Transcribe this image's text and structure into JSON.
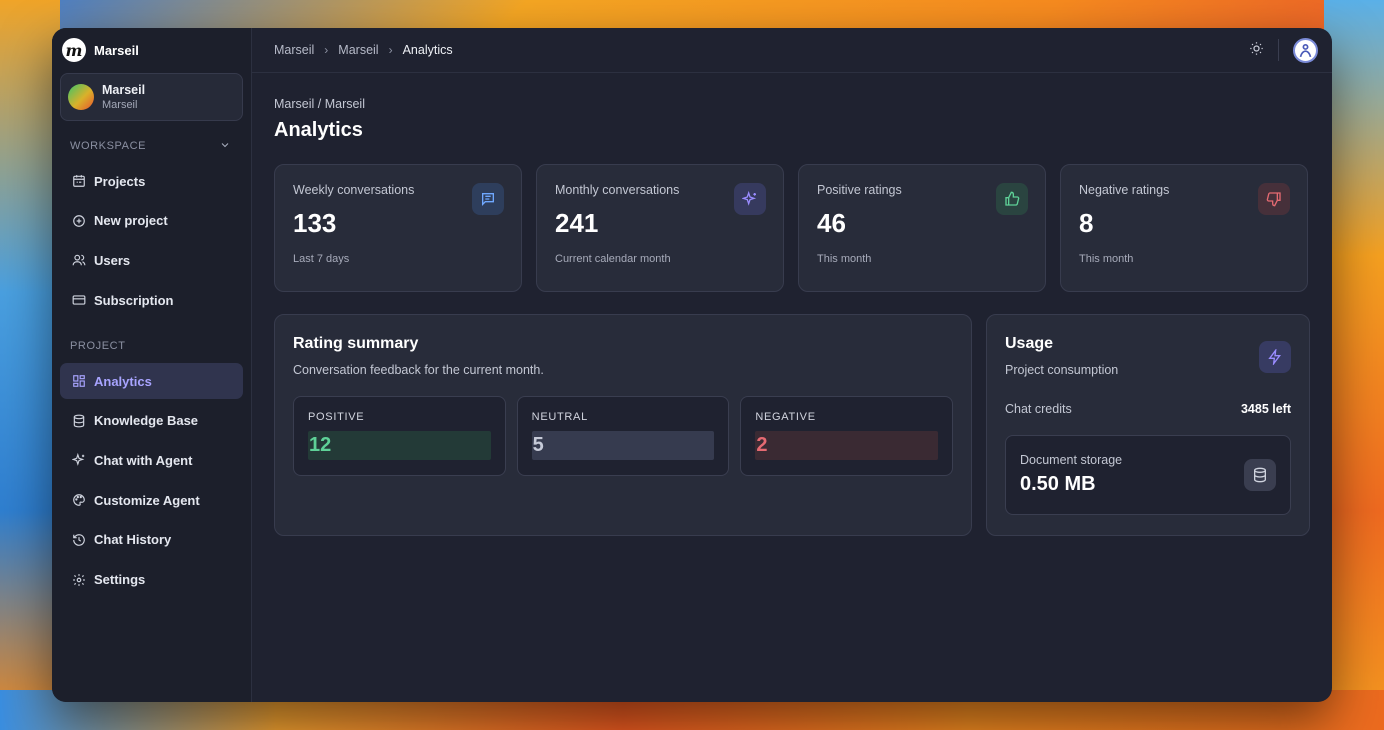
{
  "brand": {
    "name": "Marseil"
  },
  "account": {
    "name": "Marseil",
    "sub": "Marseil"
  },
  "sidebar": {
    "workspace_label": "WORKSPACE",
    "workspace_items": [
      {
        "label": "Projects",
        "icon": "calendar-icon"
      },
      {
        "label": "New project",
        "icon": "plus-circle-icon"
      },
      {
        "label": "Users",
        "icon": "users-icon"
      },
      {
        "label": "Subscription",
        "icon": "credit-card-icon"
      }
    ],
    "project_label": "PROJECT",
    "project_items": [
      {
        "label": "Analytics",
        "icon": "grid-icon",
        "active": true
      },
      {
        "label": "Knowledge Base",
        "icon": "database-icon"
      },
      {
        "label": "Chat with Agent",
        "icon": "sparkles-icon"
      },
      {
        "label": "Customize Agent",
        "icon": "palette-icon"
      },
      {
        "label": "Chat History",
        "icon": "history-icon"
      },
      {
        "label": "Settings",
        "icon": "gear-icon"
      }
    ]
  },
  "topbar": {
    "breadcrumbs": [
      "Marseil",
      "Marseil",
      "Analytics"
    ]
  },
  "page": {
    "crumb": "Marseil / Marseil",
    "title": "Analytics"
  },
  "stats": [
    {
      "label": "Weekly conversations",
      "value": "133",
      "sub": "Last 7 days",
      "icon": "message-icon",
      "color": "#6fa8ff"
    },
    {
      "label": "Monthly conversations",
      "value": "241",
      "sub": "Current calendar month",
      "icon": "sparkles-icon",
      "color": "#9a8cff"
    },
    {
      "label": "Positive ratings",
      "value": "46",
      "sub": "This month",
      "icon": "thumbs-up-icon",
      "color": "#5ed197"
    },
    {
      "label": "Negative ratings",
      "value": "8",
      "sub": "This month",
      "icon": "thumbs-down-icon",
      "color": "#e56a72"
    }
  ],
  "rating": {
    "title": "Rating summary",
    "subtitle": "Conversation feedback for the current month.",
    "tiles": [
      {
        "label": "POSITIVE",
        "value": "12"
      },
      {
        "label": "NEUTRAL",
        "value": "5"
      },
      {
        "label": "NEGATIVE",
        "value": "2"
      }
    ]
  },
  "usage": {
    "title": "Usage",
    "subtitle": "Project consumption",
    "credits_label": "Chat credits",
    "credits_value": "3485 left",
    "storage_label": "Document storage",
    "storage_value": "0.50 MB",
    "icon": "lightning-icon"
  }
}
